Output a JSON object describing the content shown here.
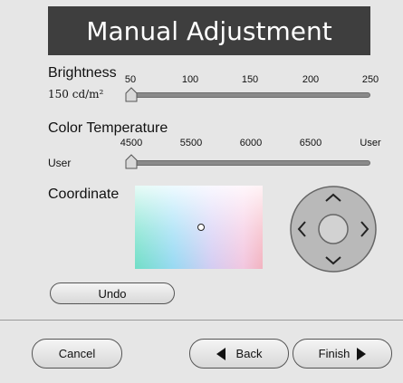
{
  "window": {
    "title": "Manual Adjustment"
  },
  "brightness": {
    "label": "Brightness",
    "value_text": "150 cd/m²",
    "ticks": [
      "50",
      "100",
      "150",
      "200",
      "250"
    ],
    "level": 0.0
  },
  "color_temperature": {
    "label": "Color Temperature",
    "value_text": "User",
    "ticks": [
      "4500",
      "5500",
      "6000",
      "6500",
      "User"
    ],
    "level": 0.0
  },
  "coordinate": {
    "label": "Coordinate",
    "marker": {
      "x_fraction": 0.52,
      "y_fraction": 0.5
    }
  },
  "dpad": {
    "icons": [
      "chevron-up-icon",
      "chevron-down-icon",
      "chevron-left-icon",
      "chevron-right-icon"
    ]
  },
  "buttons": {
    "undo": "Undo",
    "cancel": "Cancel",
    "back": "Back",
    "finish": "Finish"
  },
  "colors": {
    "title_bg": "#3e3e3e",
    "window_bg": "#e6e6e6",
    "track": "#8a8a8a"
  }
}
